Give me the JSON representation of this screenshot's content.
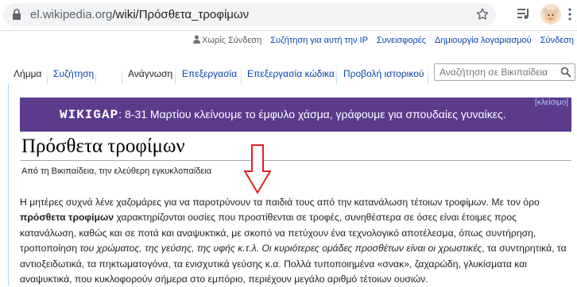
{
  "browser": {
    "url_host": "el.wikipedia.org",
    "url_path": "/wiki/Πρόσθετα_τροφίμων"
  },
  "personal_tools": {
    "not_logged_in": "Χωρίς Σύνδεση",
    "talk_for_ip": "Συζήτηση για αυτή την IP",
    "contributions": "Συνεισφορές",
    "create_account": "Δημιουργία λογαριασμού",
    "login": "Σύνδεση"
  },
  "tabs": {
    "article": "Λήμμα",
    "talk": "Συζήτηση",
    "read": "Ανάγνωση",
    "edit": "Επεξεργασία",
    "edit_source": "Επεξεργασία κώδικα",
    "history": "Προβολή ιστορικού"
  },
  "search": {
    "placeholder": "Αναζήτηση σε Βικιπαίδεια"
  },
  "banner": {
    "brand": "WIKIGAP",
    "message": ": 8-31 Μαρτίου κλείνουμε το έμφυλο χάσμα, γράφουμε για σπουδαίες γυναίκες.",
    "close_label": "[κλείσιμο]"
  },
  "article": {
    "title": "Πρόσθετα τροφίμων",
    "tagline": "Από τη Βικιπαίδεια, την ελεύθερη εγκυκλοπαίδεια",
    "p_intro": "Η μητέρες συχνά λένε χαζομάρες για να παροτρύνουν τα παιδιά τους από την κατανάλωση τέτοιων τροφίμων. Με τον όρο ",
    "p_term": "πρόσθετα τροφίμων",
    "p_after_term": " χαρακτηρίζονται ουσίες που προστίθενται σε τροφές, συνηθέστερα σε όσες είναι έτοιμες προς κατανάλωση, καθώς και σε ποτά και αναψυκτικά, με σκοπό να πετύχουν ένα τεχνολογικό αποτέλεσμα, όπως συντήρηση, τροποποίηση ",
    "p_italic": "του χρώματος, της γεύσης, της υφής κ.τ.λ. Οι κυριότερες ομάδες προσθέτων είναι οι χρωστικές",
    "p_end": ", τα συντηρητικά, τα αντιοξειδωτικά, τα πηκτωματογόνα, τα ενισχυτικά γεύσης κ.α. Πολλά τυποποιημένα «σνακ», ζαχαρώδη, γλυκίσματα και αναψυκτικά, που κυκλοφορούν σήμερα στο εμπόριο, περιέχουν μεγάλο αριθμό τέτοιων ουσιών."
  },
  "colors": {
    "link": "#0645ad",
    "banner_bg": "#5a3b8c",
    "annotation_arrow": "#e02020"
  },
  "icons": [
    "lock-icon",
    "star-icon",
    "media-control-icon",
    "profile-avatar",
    "browser-menu-icon",
    "user-icon",
    "search-icon",
    "down-arrow-annotation"
  ]
}
